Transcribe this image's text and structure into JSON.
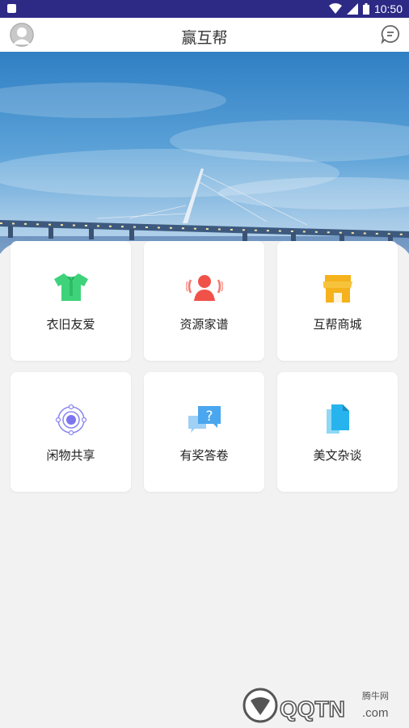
{
  "status_bar": {
    "time": "10:50"
  },
  "header": {
    "title": "赢互帮"
  },
  "grid": {
    "items": [
      {
        "label": "衣旧友爱",
        "icon": "shirt-icon"
      },
      {
        "label": "资源家谱",
        "icon": "people-icon"
      },
      {
        "label": "互帮商城",
        "icon": "store-icon"
      },
      {
        "label": "闲物共享",
        "icon": "orbit-icon"
      },
      {
        "label": "有奖答卷",
        "icon": "question-chat-icon"
      },
      {
        "label": "美文杂谈",
        "icon": "document-icon"
      }
    ]
  },
  "watermark": {
    "site": "QQTN.com",
    "brand": "腾牛网"
  },
  "colors": {
    "status_bar": "#2d2a86",
    "shirt": "#3ed37a",
    "people": "#f0524a",
    "store": "#f5b21c",
    "orbit": "#8a86f2",
    "question": "#4aa6ee",
    "document": "#27b4ee"
  }
}
